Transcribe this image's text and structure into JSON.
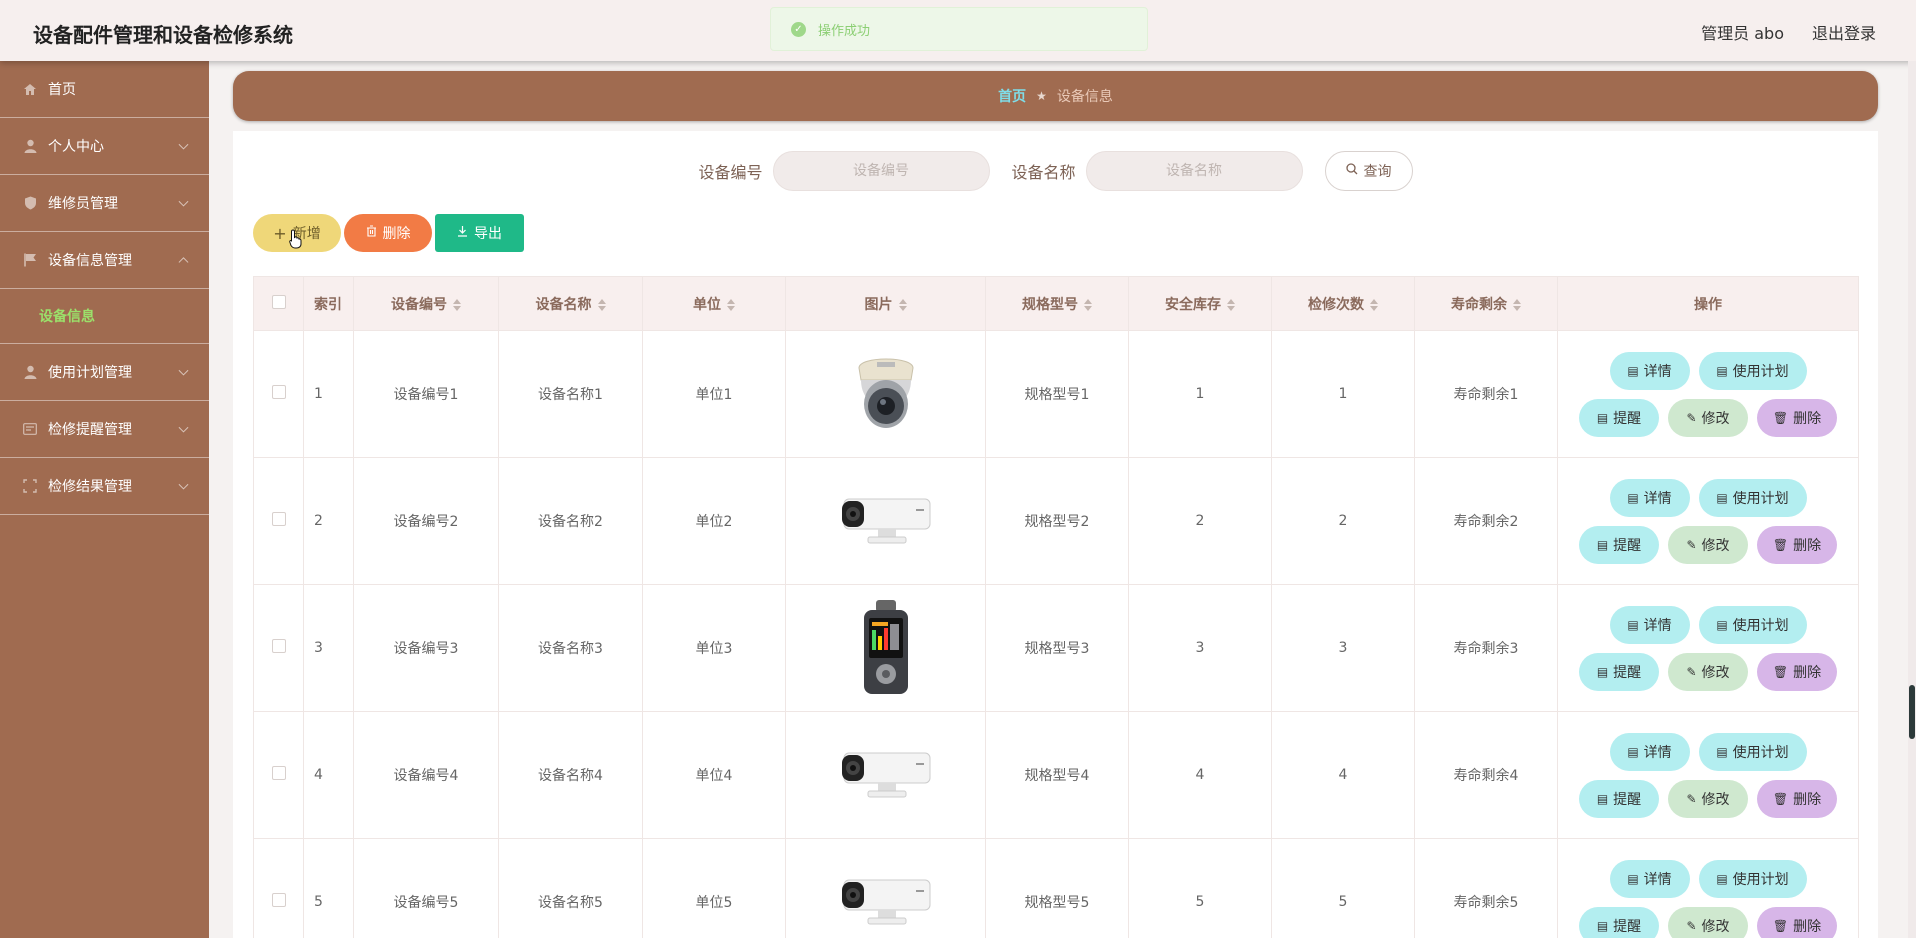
{
  "app": {
    "title": "设备配件管理和设备检修系统"
  },
  "toast": {
    "message": "操作成功"
  },
  "user": {
    "name": "管理员 abo",
    "logout": "退出登录"
  },
  "sidebar": {
    "items": [
      {
        "label": "首页",
        "icon": "home-icon"
      },
      {
        "label": "个人中心",
        "icon": "user-icon"
      },
      {
        "label": "维修员管理",
        "icon": "shield-icon"
      },
      {
        "label": "设备信息管理",
        "icon": "flag-icon"
      },
      {
        "label": "使用计划管理",
        "icon": "user-icon"
      },
      {
        "label": "检修提醒管理",
        "icon": "card-icon"
      },
      {
        "label": "检修结果管理",
        "icon": "frame-icon"
      }
    ],
    "subitem": "设备信息"
  },
  "breadcrumb": {
    "home": "首页",
    "current": "设备信息"
  },
  "search": {
    "code_label": "设备编号",
    "code_placeholder": "设备编号",
    "name_label": "设备名称",
    "name_placeholder": "设备名称",
    "query_label": "查询"
  },
  "toolbar": {
    "add": "新增",
    "delete": "删除",
    "export": "导出"
  },
  "table": {
    "headers": [
      "索引",
      "设备编号",
      "设备名称",
      "单位",
      "图片",
      "规格型号",
      "安全库存",
      "检修次数",
      "寿命剩余",
      "操作"
    ],
    "rows": [
      {
        "index": "1",
        "code": "设备编号1",
        "name": "设备名称1",
        "unit": "单位1",
        "image": "dome-camera",
        "model": "规格型号1",
        "stock": "1",
        "repairs": "1",
        "life": "寿命剩余1"
      },
      {
        "index": "2",
        "code": "设备编号2",
        "name": "设备名称2",
        "unit": "单位2",
        "image": "bullet-camera",
        "model": "规格型号2",
        "stock": "2",
        "repairs": "2",
        "life": "寿命剩余2"
      },
      {
        "index": "3",
        "code": "设备编号3",
        "name": "设备名称3",
        "unit": "单位3",
        "image": "handheld-device",
        "model": "规格型号3",
        "stock": "3",
        "repairs": "3",
        "life": "寿命剩余3"
      },
      {
        "index": "4",
        "code": "设备编号4",
        "name": "设备名称4",
        "unit": "单位4",
        "image": "bullet-camera",
        "model": "规格型号4",
        "stock": "4",
        "repairs": "4",
        "life": "寿命剩余4"
      },
      {
        "index": "5",
        "code": "设备编号5",
        "name": "设备名称5",
        "unit": "单位5",
        "image": "bullet-camera",
        "model": "规格型号5",
        "stock": "5",
        "repairs": "5",
        "life": "寿命剩余5"
      }
    ],
    "actions": {
      "detail": "详情",
      "plan": "使用计划",
      "remind": "提醒",
      "edit": "修改",
      "delete": "删除"
    }
  },
  "colors": {
    "sidebar": "#a06b50",
    "accent_green": "#9be06a",
    "export": "#1fb988",
    "delete": "#f27b45",
    "add": "#efd779"
  }
}
